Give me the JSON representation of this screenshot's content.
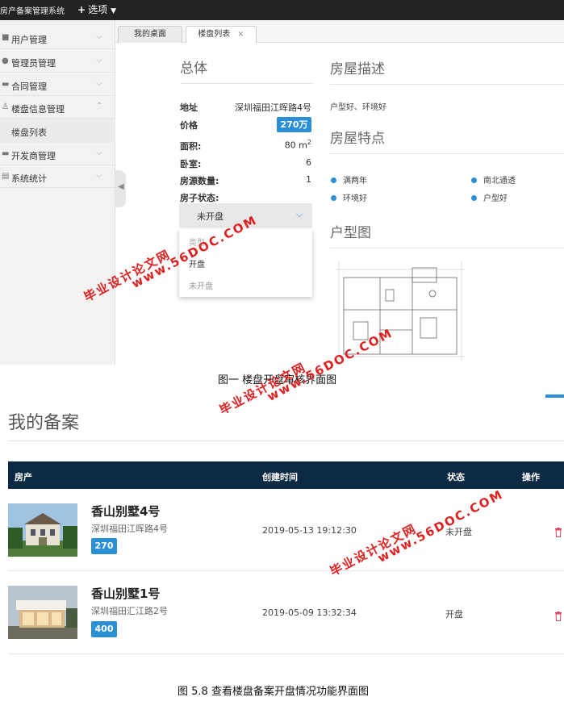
{
  "screenshot1": {
    "app_title": "房产备案管理系统",
    "options_label": "选项",
    "sidebar": {
      "items": [
        {
          "label": "用户管理",
          "icon": "users-icon"
        },
        {
          "label": "管理员管理",
          "icon": "user-icon"
        },
        {
          "label": "合同管理",
          "icon": "folder-icon"
        },
        {
          "label": "楼盘信息管理",
          "icon": "person-icon"
        },
        {
          "label": "开发商管理",
          "icon": "folder-icon"
        },
        {
          "label": "系统统计",
          "icon": "chart-icon"
        }
      ],
      "sub_item": "楼盘列表"
    },
    "tabs": [
      {
        "label": "我的桌面"
      },
      {
        "label": "楼盘列表",
        "close": "×"
      }
    ],
    "overview": {
      "title": "总体",
      "address_label": "地址",
      "address": "深圳福田江晖路4号",
      "price_label": "价格",
      "price": "270万",
      "area_label": "面积:",
      "area": "80 m",
      "area_unit_sup": "2",
      "bedrooms_label": "卧室:",
      "bedrooms": "6",
      "count_label": "房源数量:",
      "count": "1",
      "status_label": "房子状态:",
      "status_value": "未开盘",
      "dropdown_options": [
        "类型",
        "开盘",
        "未开盘"
      ]
    },
    "description": {
      "title": "房屋描述",
      "text": "户型好、环境好"
    },
    "features": {
      "title": "房屋特点",
      "items": [
        "满两年",
        "南北通透",
        "环境好",
        "户型好"
      ]
    },
    "floorplan_title": "户型图",
    "caption": "图一 楼盘开盘审核界面图"
  },
  "screenshot2": {
    "title": "我的备案",
    "columns": [
      "房产",
      "创建时间",
      "状态",
      "操作"
    ],
    "rows": [
      {
        "name": "香山别墅4号",
        "address": "深圳福田江晖路4号",
        "price": "270",
        "created": "2019-05-13 19:12:30",
        "status": "未开盘"
      },
      {
        "name": "香山别墅1号",
        "address": "深圳福田汇江路2号",
        "price": "400",
        "created": "2019-05-09 13:32:34",
        "status": "开盘"
      }
    ]
  },
  "caption2": "图 5.8 查看楼盘备案开盘情况功能界面图",
  "watermark": {
    "cn": "毕业设计论文网",
    "url": "www.56DOC.COM"
  },
  "colors": {
    "accent": "#2b8fd6",
    "table_header": "#0d2a44",
    "watermark": "#e02020"
  }
}
